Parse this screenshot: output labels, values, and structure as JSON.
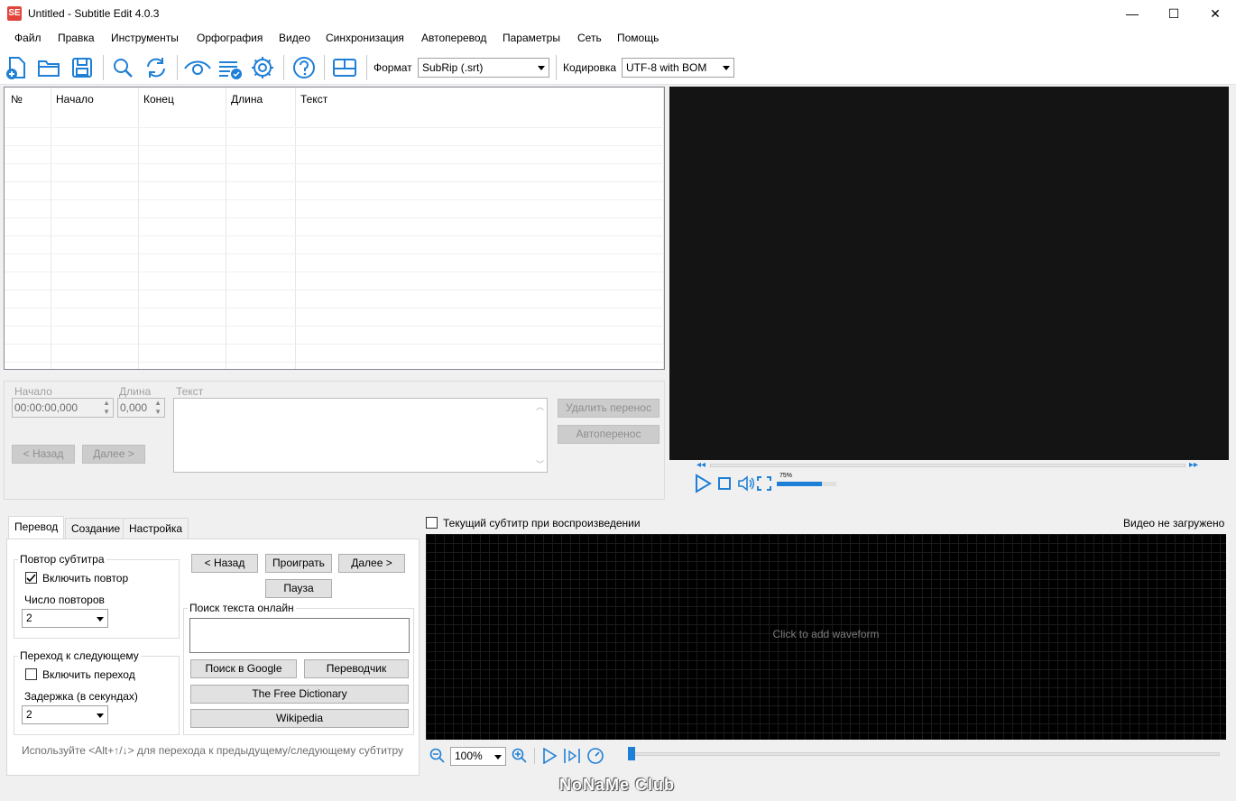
{
  "window": {
    "title": "Untitled - Subtitle Edit 4.0.3",
    "logo_text": "SE",
    "minimize": "—",
    "maximize": "☐",
    "close": "✕"
  },
  "menu": [
    "Файл",
    "Правка",
    "Инструменты",
    "Орфография",
    "Видео",
    "Синхронизация",
    "Автоперевод",
    "Параметры",
    "Сеть",
    "Помощь"
  ],
  "toolbar": {
    "format_label": "Формат",
    "format_value": "SubRip (.srt)",
    "encoding_label": "Кодировка",
    "encoding_value": "UTF-8 with BOM",
    "icons": [
      "new-file-icon",
      "open-folder-icon",
      "save-icon",
      "find-icon",
      "replace-icon",
      "visual-sync-icon",
      "spell-check-icon",
      "settings-icon",
      "help-icon",
      "layout-icon"
    ]
  },
  "grid": {
    "columns": [
      "№",
      "Начало",
      "Конец",
      "Длина",
      "Текст"
    ],
    "rows": []
  },
  "edit": {
    "start_label": "Начало",
    "start_value": "00:00:00,000",
    "duration_label": "Длина",
    "duration_value": "0,000",
    "text_label": "Текст",
    "prev_button": "< Назад",
    "next_button": "Далее >",
    "remove_break_button": "Удалить перенос",
    "auto_break_button": "Автоперенос"
  },
  "video": {
    "volume_label": "75%",
    "volume_level": 0.75,
    "show_current_label": "Текущий субтитр при воспроизведении",
    "not_loaded": "Видео не загружено"
  },
  "tabs": {
    "items": [
      "Перевод",
      "Создание",
      "Настройка"
    ],
    "active": "Перевод",
    "repeat_group": "Повтор субтитра",
    "enable_repeat": "Включить повтор",
    "repeat_count_label": "Число повторов",
    "repeat_count_value": "2",
    "next_group": "Переход к следующему",
    "enable_next": "Включить переход",
    "delay_label": "Задержка (в секундах)",
    "delay_value": "2",
    "back_button": "< Назад",
    "play_button": "Проиграть",
    "forward_button": "Далее >",
    "pause_button": "Пауза",
    "search_group": "Поиск текста онлайн",
    "google_button": "Поиск в Google",
    "translator_button": "Переводчик",
    "free_dictionary_button": "The Free Dictionary",
    "wikipedia_button": "Wikipedia",
    "hint": "Используйте <Alt+↑/↓> для перехода к предыдущему/следующему субтитру"
  },
  "waveform": {
    "placeholder": "Click to add waveform",
    "zoom_value": "100%"
  },
  "watermark": "NoNaMe Club"
}
